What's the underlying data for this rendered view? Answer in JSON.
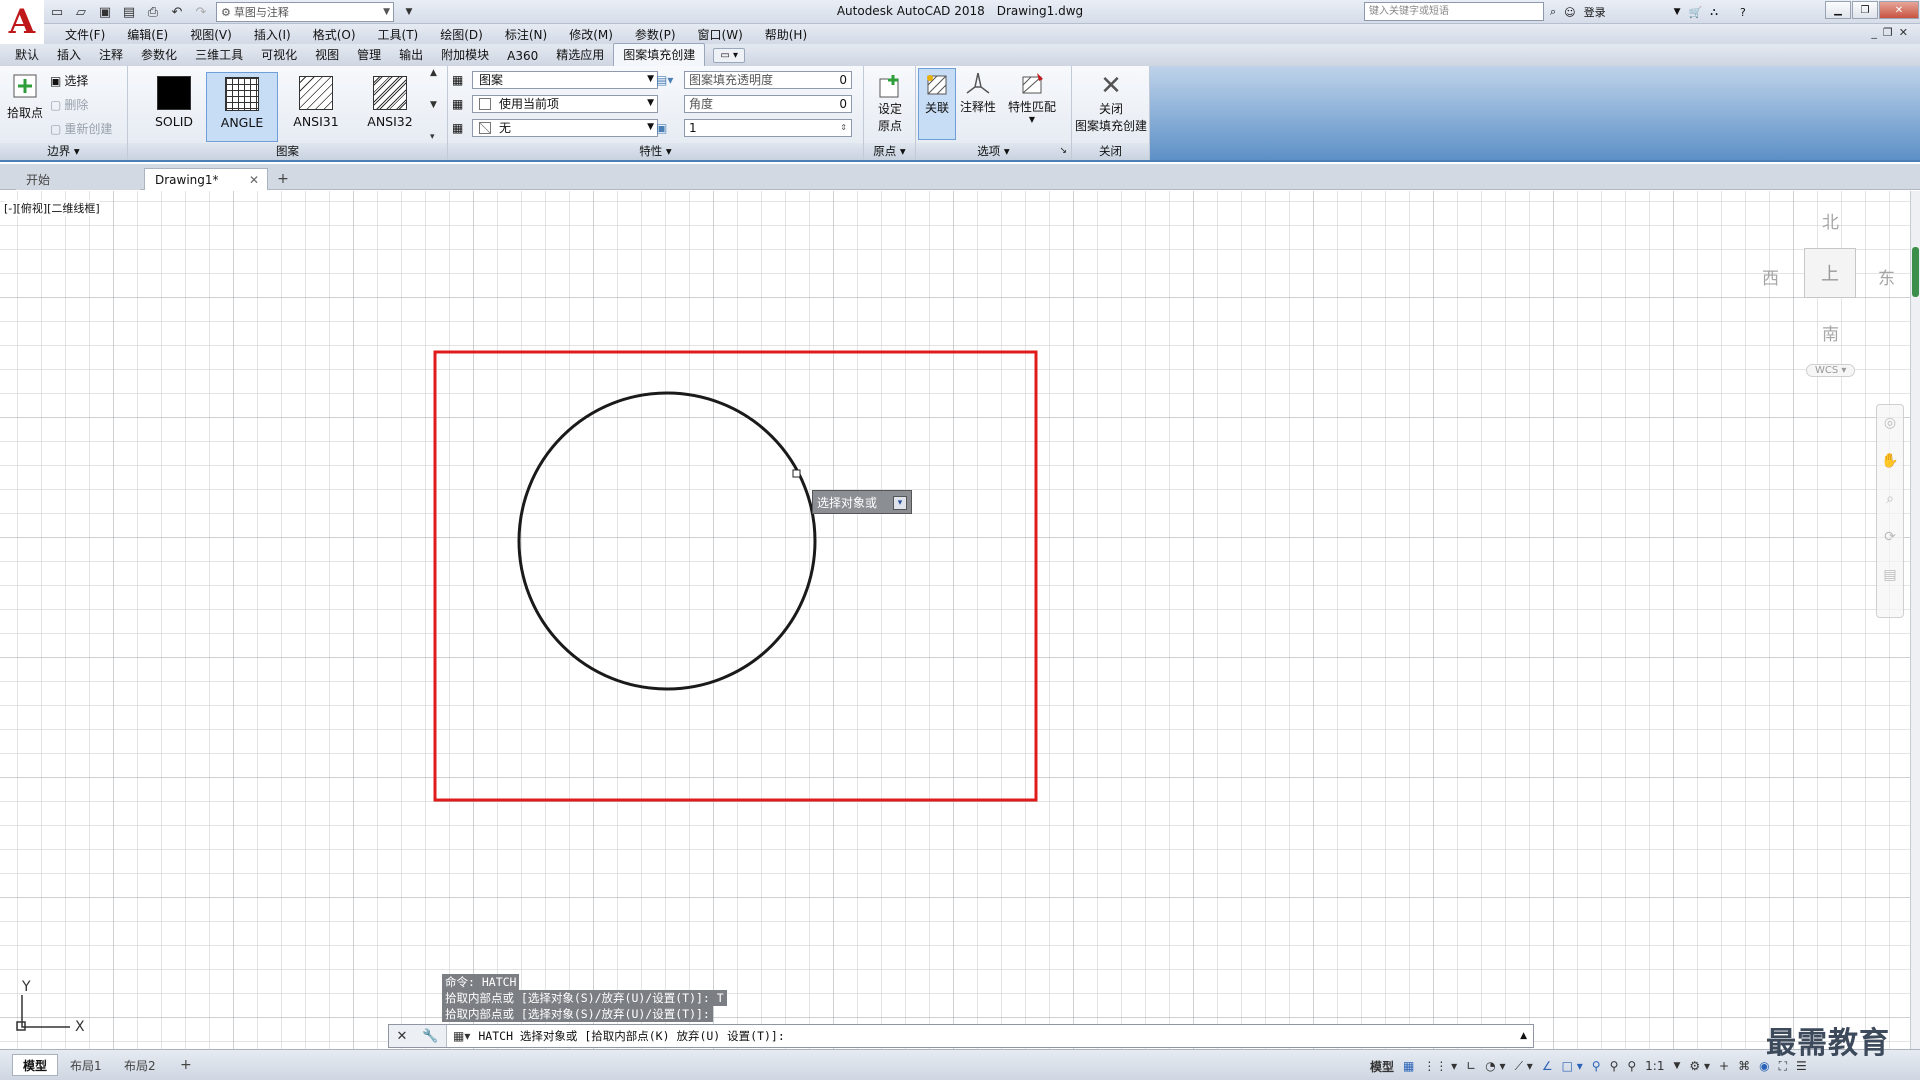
{
  "app": {
    "title": "Autodesk AutoCAD 2018",
    "file": "Drawing1.dwg",
    "logo": "A",
    "workspace": "草图与注释",
    "search_placeholder": "键入关键字或短语",
    "login": "登录"
  },
  "menu": [
    "文件(F)",
    "编辑(E)",
    "视图(V)",
    "插入(I)",
    "格式(O)",
    "工具(T)",
    "绘图(D)",
    "标注(N)",
    "修改(M)",
    "参数(P)",
    "窗口(W)",
    "帮助(H)"
  ],
  "ribbon_tabs": [
    "默认",
    "插入",
    "注释",
    "参数化",
    "三维工具",
    "可视化",
    "视图",
    "管理",
    "输出",
    "附加模块",
    "A360",
    "精选应用",
    "图案填充创建"
  ],
  "ribbon": {
    "boundary": {
      "pick_label": "拾取点",
      "select_label": "选择",
      "remove_label": "删除",
      "recreate_label": "重新创建",
      "title": "边界"
    },
    "pattern": {
      "swatches": [
        "SOLID",
        "ANGLE",
        "ANSI31",
        "ANSI32"
      ],
      "selected": "ANGLE",
      "title": "图案"
    },
    "properties": {
      "type_value": "图案",
      "color_value": "使用当前项",
      "bg_value": "无",
      "transparency_label": "图案填充透明度",
      "transparency_value": "0",
      "angle_label": "角度",
      "angle_value": "0",
      "scale_value": "1",
      "title": "特性"
    },
    "origin": {
      "set_label_1": "设定",
      "set_label_2": "原点",
      "title": "原点"
    },
    "options": {
      "assoc_label": "关联",
      "annot_label": "注释性",
      "match_label": "特性匹配",
      "title": "选项"
    },
    "close": {
      "label_1": "关闭",
      "label_2": "图案填充创建",
      "title": "关闭"
    }
  },
  "doc_tabs": {
    "start": "开始",
    "active": "Drawing1*"
  },
  "viewport": {
    "label": "[-][俯视][二维线框]"
  },
  "viewcube": {
    "north": "北",
    "south": "南",
    "east": "东",
    "west": "西",
    "face": "上",
    "wcs": "WCS"
  },
  "tooltip": "选择对象或",
  "command_history": [
    "命令: HATCH",
    "拾取内部点或 [选择对象(S)/放弃(U)/设置(T)]: T",
    "拾取内部点或 [选择对象(S)/放弃(U)/设置(T)]:"
  ],
  "command_line": "HATCH 选择对象或 [拾取内部点(K) 放弃(U) 设置(T)]:",
  "layout_tabs": [
    "模型",
    "布局1",
    "布局2"
  ],
  "status": {
    "model": "模型",
    "scale": "1:1"
  },
  "watermark": "最需教育",
  "colors": {
    "accent": "#4b7fb6",
    "boundary_rect": "#e01b1b",
    "logo": "#c0171a"
  }
}
